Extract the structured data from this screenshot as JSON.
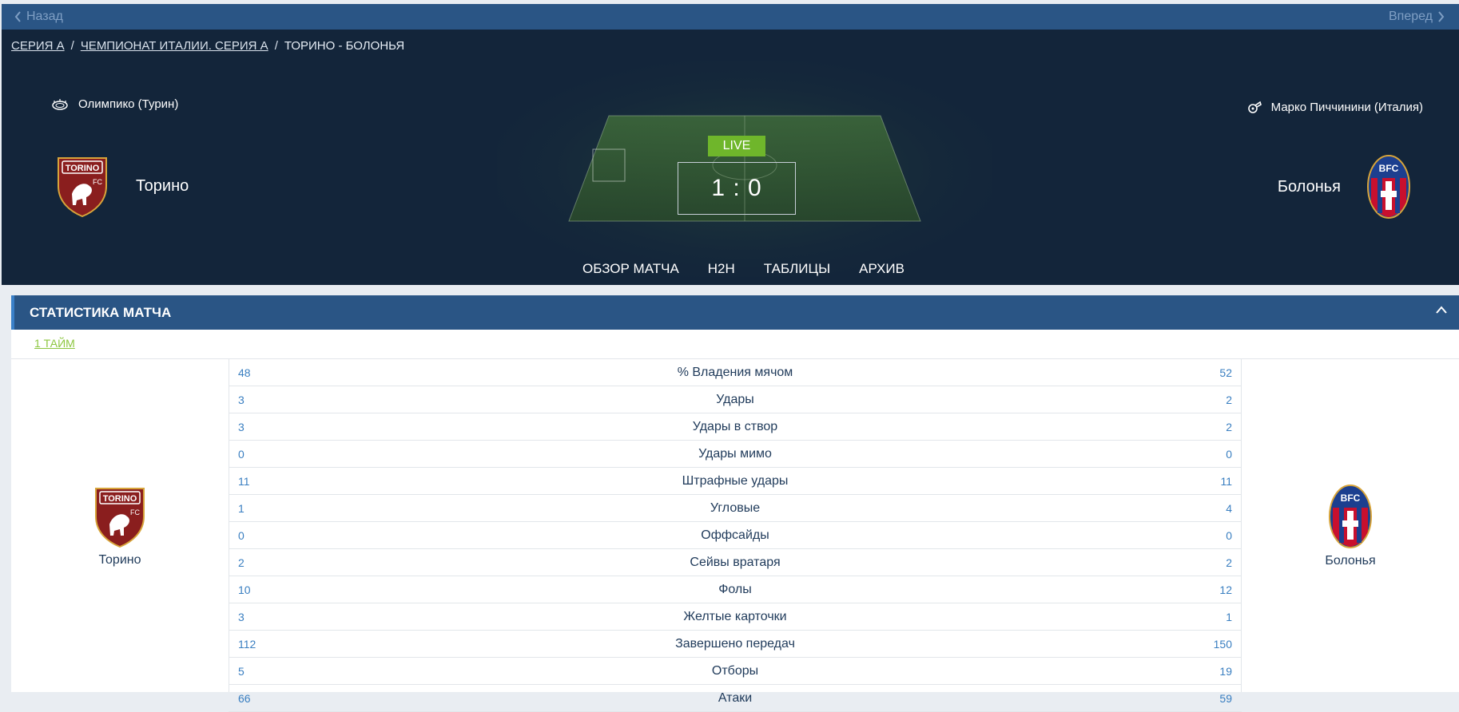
{
  "topbar": {
    "back_label": "Назад",
    "forward_label": "Вперед"
  },
  "breadcrumb": {
    "items": [
      "СЕРИЯ А",
      "ЧЕМПИОНАТ ИТАЛИИ. СЕРИЯ А",
      "ТОРИНО - БОЛОНЬЯ"
    ],
    "separator": "/"
  },
  "match": {
    "venue": "Олимпико (Турин)",
    "referee": "Марко Пиччинини (Италия)",
    "home": "Торино",
    "away": "Болонья",
    "status": "LIVE",
    "score": "1 : 0"
  },
  "tabs": [
    "ОБЗОР МАТЧА",
    "H2H",
    "ТАБЛИЦЫ",
    "АРХИВ"
  ],
  "stats_panel": {
    "title": "СТАТИСТИКА МАТЧА",
    "period": "1 ТАЙМ",
    "rows": [
      {
        "home": "48",
        "label": "% Владения мячом",
        "away": "52"
      },
      {
        "home": "3",
        "label": "Удары",
        "away": "2"
      },
      {
        "home": "3",
        "label": "Удары в створ",
        "away": "2"
      },
      {
        "home": "0",
        "label": "Удары мимо",
        "away": "0"
      },
      {
        "home": "11",
        "label": "Штрафные удары",
        "away": "11"
      },
      {
        "home": "1",
        "label": "Угловые",
        "away": "4"
      },
      {
        "home": "0",
        "label": "Оффсайды",
        "away": "0"
      },
      {
        "home": "2",
        "label": "Сейвы вратаря",
        "away": "2"
      },
      {
        "home": "10",
        "label": "Фолы",
        "away": "12"
      },
      {
        "home": "3",
        "label": "Желтые карточки",
        "away": "1"
      },
      {
        "home": "112",
        "label": "Завершено передач",
        "away": "150"
      },
      {
        "home": "5",
        "label": "Отборы",
        "away": "19"
      },
      {
        "home": "66",
        "label": "Атаки",
        "away": "59"
      }
    ]
  },
  "colors": {
    "accent_blue": "#2a5585",
    "live_green": "#6fb62b",
    "link_green": "#8cc63f",
    "stat_value_blue": "#3a7fc1"
  },
  "icons": [
    "chevron-left-icon",
    "chevron-right-icon",
    "stadium-icon",
    "whistle-icon",
    "torino-crest-icon",
    "bologna-crest-icon",
    "chevron-up-icon"
  ]
}
